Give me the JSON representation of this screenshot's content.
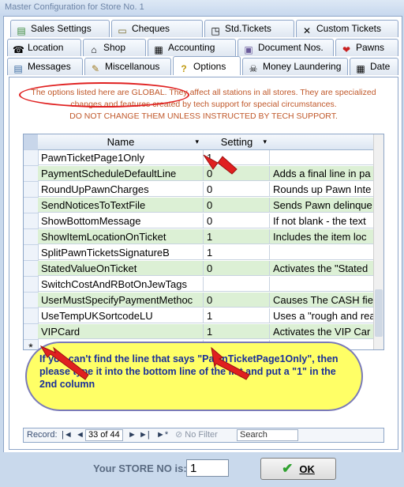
{
  "window": {
    "title": "Master Configuration for Store No. 1"
  },
  "tabs": {
    "row1": [
      {
        "label": "Sales Settings",
        "icon": "money-icon"
      },
      {
        "label": "Cheques",
        "icon": "cheque-icon"
      },
      {
        "label": "Std.Tickets",
        "icon": "ticket-icon"
      },
      {
        "label": "Custom Tickets",
        "icon": "tools-icon"
      }
    ],
    "row2": [
      {
        "label": "Location",
        "icon": "phone-icon"
      },
      {
        "label": "Shop",
        "icon": "house-icon"
      },
      {
        "label": "Accounting",
        "icon": "calculator-icon"
      },
      {
        "label": "Document Nos.",
        "icon": "folder-icon"
      },
      {
        "label": "Pawns",
        "icon": "rings-icon"
      }
    ],
    "row3": [
      {
        "label": "Messages",
        "icon": "messages-icon"
      },
      {
        "label": "Miscellanous",
        "icon": "pencil-icon"
      },
      {
        "label": "Options",
        "icon": "question-icon",
        "active": true
      },
      {
        "label": "Money Laundering",
        "icon": "skull-icon"
      },
      {
        "label": "Date",
        "icon": "calendar-icon"
      }
    ]
  },
  "notice": {
    "line1": "The options listed here are GLOBAL.  They affect all stations in all stores.  They are specialized",
    "line2": "changes and features created by tech support for special circumstances.",
    "line3": "DO NOT CHANGE THEM UNLESS INSTRUCTED BY TECH SUPPORT."
  },
  "grid": {
    "headers": {
      "name": "Name",
      "setting": "Setting",
      "description": ""
    },
    "rows": [
      {
        "name": "PawnTicketPage1Only",
        "setting": "1",
        "description": "",
        "alt": false
      },
      {
        "name": "PaymentScheduleDefaultLine",
        "setting": "0",
        "description": "Adds a final line in pa",
        "alt": true
      },
      {
        "name": "RoundUpPawnCharges",
        "setting": "0",
        "description": "Rounds up Pawn Inte",
        "alt": false
      },
      {
        "name": "SendNoticesToTextFile",
        "setting": "0",
        "description": "Sends Pawn delinque",
        "alt": true
      },
      {
        "name": "ShowBottomMessage",
        "setting": "0",
        "description": "If not blank - the text",
        "alt": false
      },
      {
        "name": "ShowItemLocationOnTicket",
        "setting": "1",
        "description": "Includes the item loc",
        "alt": true
      },
      {
        "name": "SplitPawnTicketsSignatureB",
        "setting": "1",
        "description": "",
        "alt": false
      },
      {
        "name": "StatedValueOnTicket",
        "setting": "0",
        "description": "Activates the \"Stated",
        "alt": true
      },
      {
        "name": "SwitchCostAndRBotOnJewTags",
        "setting": "",
        "description": "",
        "alt": false
      },
      {
        "name": "UserMustSpecifyPaymentMethoc",
        "setting": "0",
        "description": "Causes The CASH fiel",
        "alt": true
      },
      {
        "name": "UseTempUKSortcodeLU",
        "setting": "1",
        "description": "Uses a \"rough and rea",
        "alt": false
      },
      {
        "name": "VIPCard",
        "setting": "1",
        "description": "Activates the VIP Car",
        "alt": true
      }
    ],
    "new_row_marker": "*"
  },
  "navigator": {
    "record_label": "Record:",
    "first": "|◄",
    "prev": "◄",
    "position": "33 of 44",
    "next": "►",
    "last": "►|",
    "new": "►*",
    "filter_label": "No Filter",
    "search_label": "Search"
  },
  "callout": {
    "line1": "If you can't find the line that says \"PawnTicketPage1Only\", then",
    "line2": "please type it into the bottom line of the list and put a \"1\" in the",
    "line3": "2nd column"
  },
  "footer": {
    "store_label": "Your STORE NO is:",
    "store_value": "1",
    "ok_label": "OK"
  },
  "colors": {
    "tab_border": "#8ea6c8",
    "alt_row": "#dcf0d5",
    "notice_text": "#c0582a",
    "callout_fill": "#ffff66",
    "callout_text": "#1a2f9a",
    "annotation_red": "#e02020"
  }
}
